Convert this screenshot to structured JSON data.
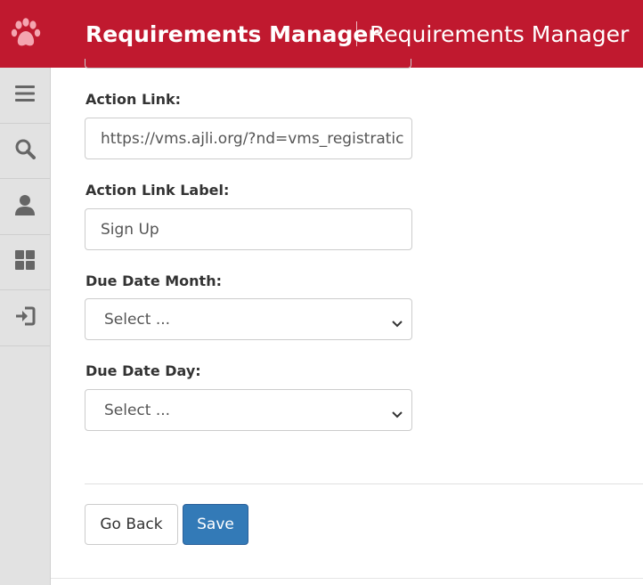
{
  "header": {
    "app_title": "Requirements Manager",
    "page_title": "Requirements Manager",
    "logo_icon": "paw-print-icon"
  },
  "sidebar": {
    "items": [
      {
        "icon": "menu-icon"
      },
      {
        "icon": "search-icon"
      },
      {
        "icon": "user-icon"
      },
      {
        "icon": "dashboard-icon"
      },
      {
        "icon": "logout-icon"
      }
    ]
  },
  "form": {
    "action_link": {
      "label": "Action Link:",
      "value": "https://vms.ajli.org/?nd=vms_registratic"
    },
    "action_link_label": {
      "label": "Action Link Label:",
      "value": "Sign Up"
    },
    "due_date_month": {
      "label": "Due Date Month:",
      "selected": "Select ..."
    },
    "due_date_day": {
      "label": "Due Date Day:",
      "selected": "Select ..."
    }
  },
  "buttons": {
    "back": "Go Back",
    "save": "Save"
  },
  "colors": {
    "brand": "#c0192f",
    "primary": "#337ab7",
    "sidebar": "#e2e2e2",
    "icon": "#666666"
  }
}
